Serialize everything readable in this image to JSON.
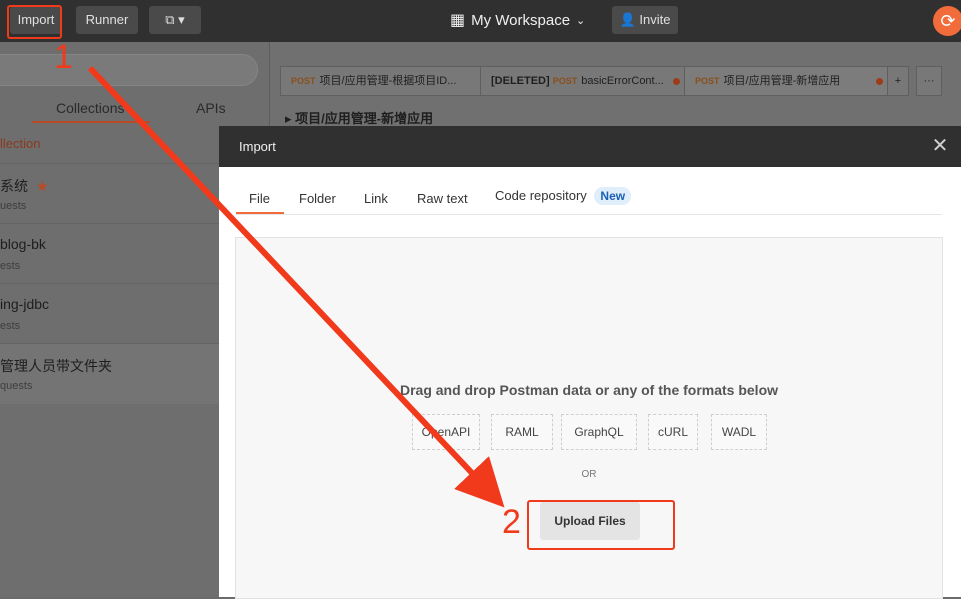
{
  "topbar": {
    "import_label": "Import",
    "runner_label": "Runner",
    "workspace_label": "My Workspace",
    "invite_label": "Invite"
  },
  "sidebar": {
    "tabs": [
      "Collections",
      "APIs"
    ],
    "new_collection": "llection",
    "collections": [
      {
        "name": "系统",
        "sub": "uests",
        "starred": true
      },
      {
        "name": "blog-bk",
        "sub": "ests"
      },
      {
        "name": "ing-jdbc",
        "sub": "ests"
      },
      {
        "name": "管理人员带文件夹",
        "sub": "quests"
      }
    ]
  },
  "request_tabs": [
    {
      "method": "POST",
      "prefix": "",
      "title": "项目/应用管理-根据项目ID..."
    },
    {
      "method": "POST",
      "prefix": "[DELETED]",
      "title": "basicErrorCont..."
    },
    {
      "method": "POST",
      "prefix": "",
      "title": "项目/应用管理-新增应用"
    }
  ],
  "breadcrumb": "项目/应用管理-新增应用",
  "modal": {
    "title": "Import",
    "tabs": [
      "File",
      "Folder",
      "Link",
      "Raw text",
      "Code repository"
    ],
    "new_badge": "New",
    "drop_text": "Drag and drop Postman data or any of the formats below",
    "formats": [
      "OpenAPI",
      "RAML",
      "GraphQL",
      "cURL",
      "WADL"
    ],
    "or_text": "OR",
    "upload_label": "Upload Files"
  },
  "annotations": {
    "step1": "1",
    "step2": "2",
    "color": "#f13a1c"
  },
  "colors": {
    "accent": "#f26b3a"
  }
}
